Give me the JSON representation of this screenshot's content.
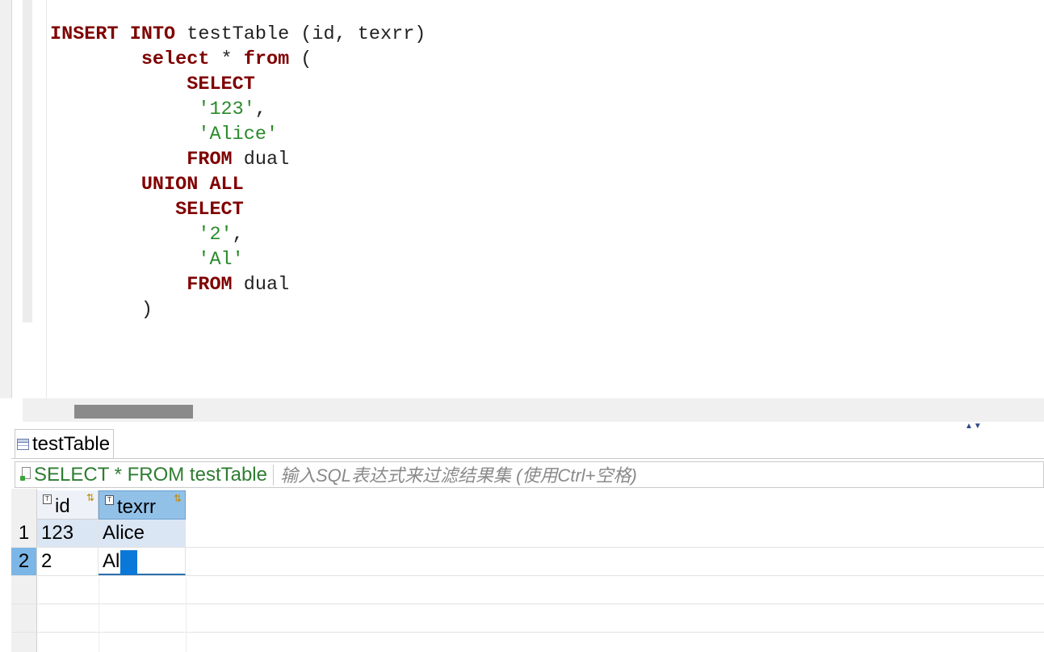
{
  "editor": {
    "lines": [
      {
        "indent": "",
        "tokens": [
          {
            "t": "kw",
            "v": "INSERT"
          },
          {
            "t": "txt",
            "v": " "
          },
          {
            "t": "kw",
            "v": "INTO"
          },
          {
            "t": "txt",
            "v": " testTable (id, texrr)"
          }
        ]
      },
      {
        "indent": "        ",
        "tokens": [
          {
            "t": "kw",
            "v": "select"
          },
          {
            "t": "txt",
            "v": " * "
          },
          {
            "t": "kw",
            "v": "from"
          },
          {
            "t": "txt",
            "v": " ("
          }
        ]
      },
      {
        "indent": "            ",
        "tokens": [
          {
            "t": "kw",
            "v": "SELECT"
          }
        ]
      },
      {
        "indent": "             ",
        "tokens": [
          {
            "t": "str",
            "v": "'123'"
          },
          {
            "t": "txt",
            "v": ","
          }
        ]
      },
      {
        "indent": "             ",
        "tokens": [
          {
            "t": "str",
            "v": "'Alice'"
          }
        ]
      },
      {
        "indent": "            ",
        "tokens": [
          {
            "t": "kw",
            "v": "FROM"
          },
          {
            "t": "txt",
            "v": " dual"
          }
        ]
      },
      {
        "indent": "        ",
        "tokens": [
          {
            "t": "kw",
            "v": "UNION"
          },
          {
            "t": "txt",
            "v": " "
          },
          {
            "t": "kw",
            "v": "ALL"
          }
        ]
      },
      {
        "indent": "           ",
        "tokens": [
          {
            "t": "kw",
            "v": "SELECT"
          }
        ]
      },
      {
        "indent": "             ",
        "tokens": [
          {
            "t": "str",
            "v": "'2'"
          },
          {
            "t": "txt",
            "v": ","
          }
        ]
      },
      {
        "indent": "             ",
        "tokens": [
          {
            "t": "str",
            "v": "'Al'"
          }
        ]
      },
      {
        "indent": "            ",
        "tokens": [
          {
            "t": "kw",
            "v": "FROM"
          },
          {
            "t": "txt",
            "v": " dual"
          }
        ]
      },
      {
        "indent": "        ",
        "tokens": [
          {
            "t": "txt",
            "v": ")"
          }
        ]
      }
    ]
  },
  "panel_controls": "▲▼",
  "results": {
    "tab_label": "testTable",
    "tab_icon": "table-icon",
    "filter": {
      "sql": "SELECT * FROM testTable",
      "placeholder": "输入SQL表达式来过滤结果集 (使用Ctrl+空格)"
    },
    "columns": [
      {
        "name": "id",
        "type_icon": "T",
        "sort_icon": "⇅"
      },
      {
        "name": "texrr",
        "type_icon": "T",
        "sort_icon": "⇅"
      }
    ],
    "rows": [
      {
        "num": "1",
        "id": "123",
        "texrr": "Alice"
      },
      {
        "num": "2",
        "id": "2",
        "texrr": "Al"
      }
    ]
  },
  "colors": {
    "keyword": "#7f0000",
    "string": "#2a8a2a",
    "selected_header": "#92c1e8",
    "cursor": "#0a78d8"
  }
}
